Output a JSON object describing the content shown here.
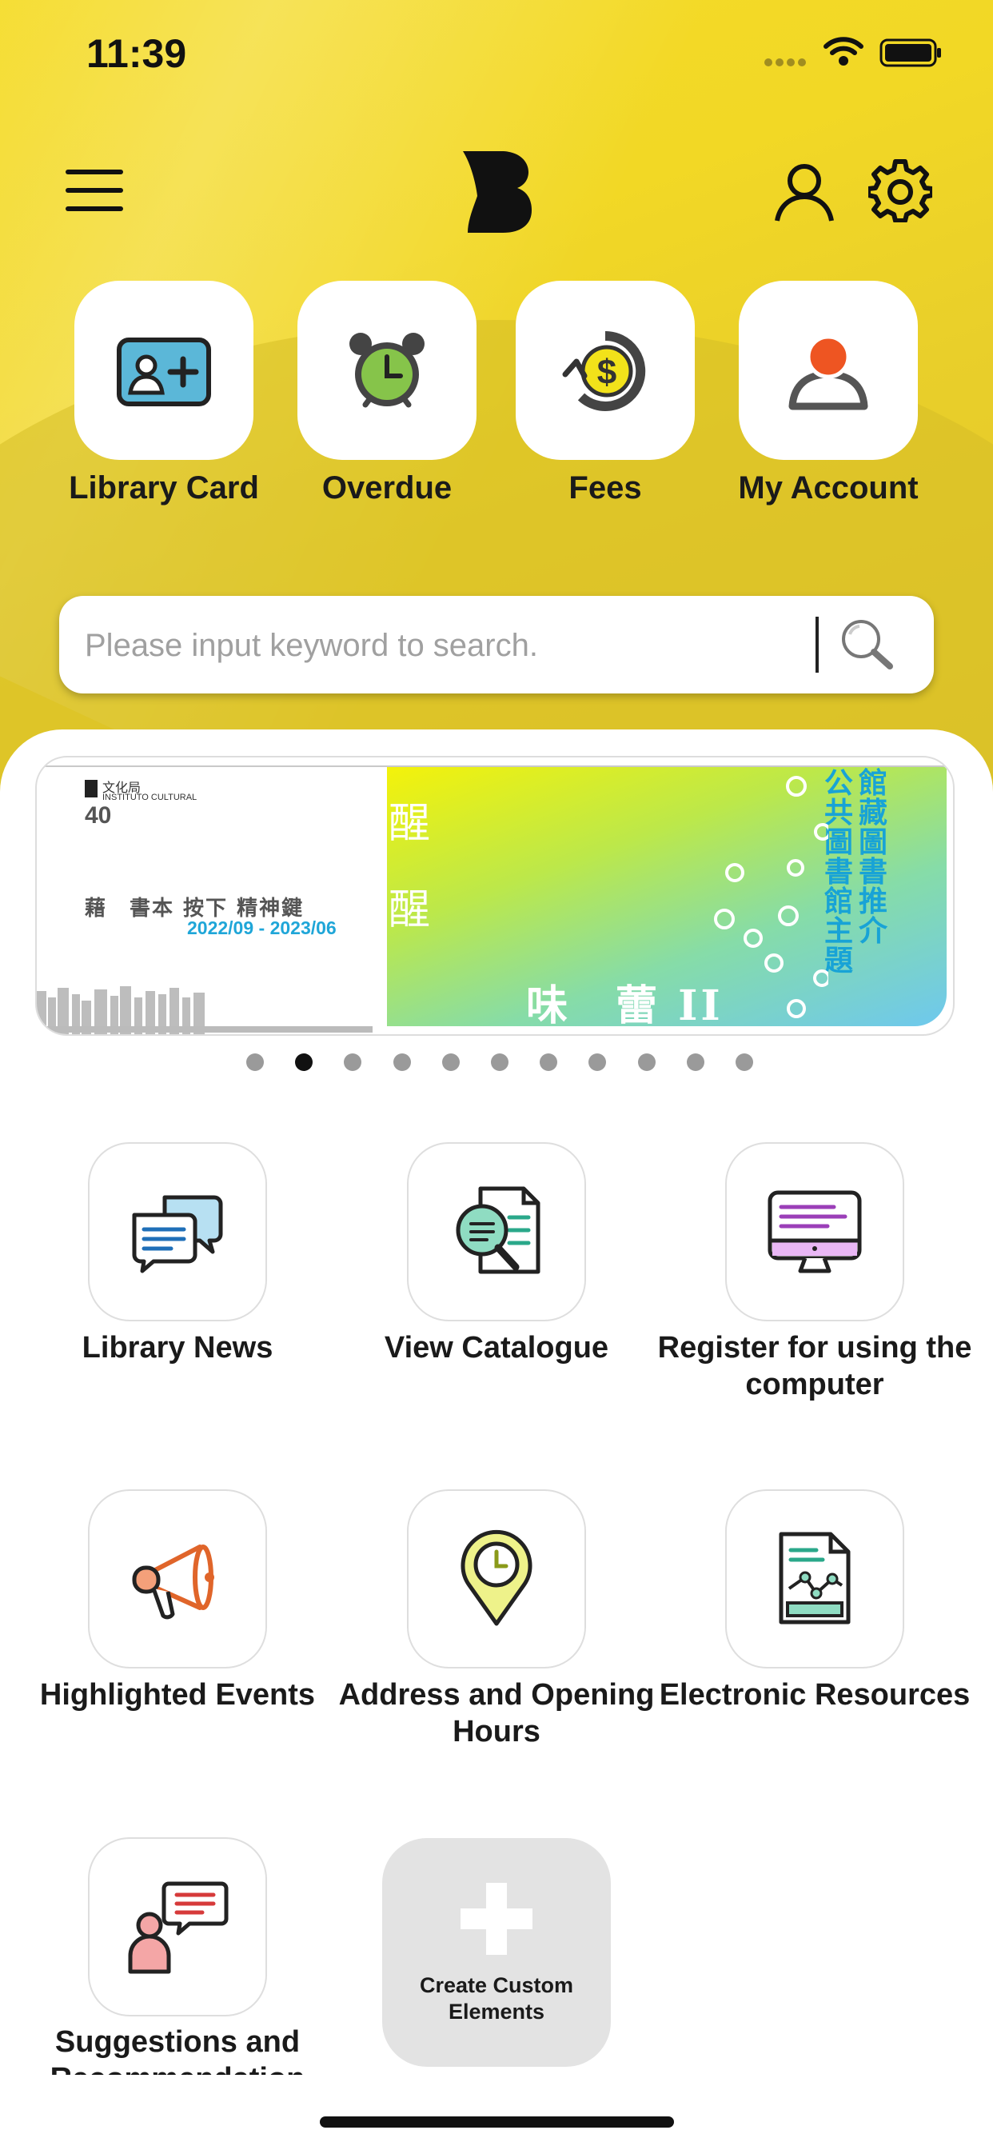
{
  "status_bar": {
    "time": "11:39"
  },
  "header": {
    "menu_icon": "hamburger-menu-icon",
    "logo_icon": "brand-b-logo",
    "account_icon": "person-icon",
    "settings_icon": "gear-icon"
  },
  "quick_actions": [
    {
      "label": "Library Card",
      "icon": "library-card-icon"
    },
    {
      "label": "Overdue",
      "icon": "alarm-clock-icon"
    },
    {
      "label": "Fees",
      "icon": "fees-dollar-icon"
    },
    {
      "label": "My Account",
      "icon": "my-account-icon"
    }
  ],
  "search": {
    "placeholder": "Please input keyword to search."
  },
  "banner": {
    "org_line1": "文化局",
    "org_line2": "INSTITUTO CULTURAL",
    "anniv": "40",
    "left_text": "藉　書本 按下 精神鍵",
    "dates": "2022/09 - 2023/06",
    "char_top": "醒",
    "char_bottom": "醒",
    "title_vertical_col1": "館藏圖書推介",
    "title_vertical_col2": "公共圖書館主題",
    "bottom_title": "味　蕾 II",
    "page_count": 11,
    "active_page": 2
  },
  "grid": [
    {
      "label": "Library News",
      "icon": "chat-bubbles-icon"
    },
    {
      "label": "View Catalogue",
      "icon": "catalogue-search-icon"
    },
    {
      "label": "Register for using the computer",
      "icon": "computer-monitor-icon"
    },
    {
      "label": "Highlighted Events",
      "icon": "megaphone-icon"
    },
    {
      "label": "Address and Opening Hours",
      "icon": "location-clock-icon"
    },
    {
      "label": "Electronic Resources",
      "icon": "e-document-icon"
    },
    {
      "label": "Suggestions and Recommendation",
      "icon": "suggestion-person-icon"
    }
  ],
  "custom_element": {
    "label": "Create Custom Elements",
    "icon": "plus-icon"
  }
}
